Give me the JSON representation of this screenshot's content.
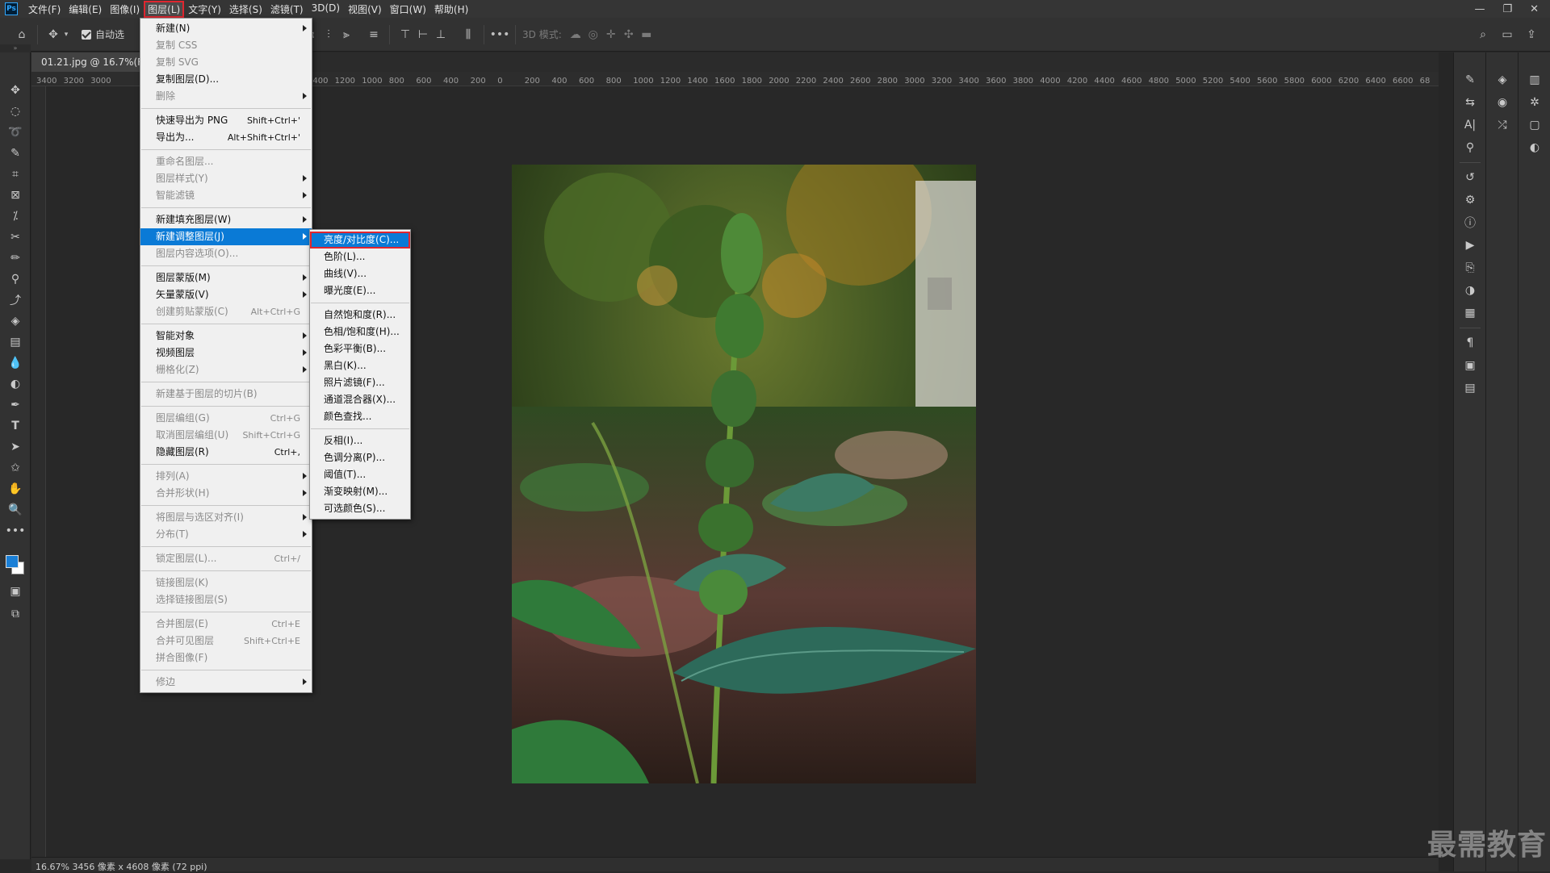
{
  "app": {
    "logo": "Ps"
  },
  "menubar": {
    "items": [
      "文件(F)",
      "编辑(E)",
      "图像(I)",
      "图层(L)",
      "文字(Y)",
      "选择(S)",
      "滤镜(T)",
      "3D(D)",
      "视图(V)",
      "窗口(W)",
      "帮助(H)"
    ],
    "active_index": 3
  },
  "window_controls": {
    "minimize": "—",
    "restore": "❐",
    "close": "✕"
  },
  "options_bar": {
    "auto_select_label": "自动选",
    "more": "•••",
    "mode_3d_label": "3D 模式:"
  },
  "document": {
    "tab_title": "01.21.jpg @ 16.7%(RGB/8)",
    "ruler_ticks": [
      "3400",
      "3200",
      "3000",
      "",
      "",
      "",
      "",
      "",
      "",
      "",
      "1400",
      "1200",
      "1000",
      "800",
      "600",
      "400",
      "200",
      "0",
      "200",
      "400",
      "600",
      "800",
      "1000",
      "1200",
      "1400",
      "1600",
      "1800",
      "2000",
      "2200",
      "2400",
      "2600",
      "2800",
      "3000",
      "3200",
      "3400",
      "3600",
      "3800",
      "4000",
      "4200",
      "4400",
      "4600",
      "4800",
      "5000",
      "5200",
      "5400",
      "5600",
      "5800",
      "6000",
      "6200",
      "6400",
      "6600",
      "68"
    ]
  },
  "status": {
    "text": "16.67%  3456 像素 x 4608 像素 (72 ppi)"
  },
  "watermark": "最需教育",
  "layer_menu": {
    "items": [
      {
        "label": "新建(N)",
        "shortcut": "",
        "submenu": true,
        "disabled": false
      },
      {
        "label": "复制 CSS",
        "shortcut": "",
        "submenu": false,
        "disabled": true
      },
      {
        "label": "复制 SVG",
        "shortcut": "",
        "submenu": false,
        "disabled": true
      },
      {
        "label": "复制图层(D)...",
        "shortcut": "",
        "submenu": false,
        "disabled": false
      },
      {
        "label": "删除",
        "shortcut": "",
        "submenu": true,
        "disabled": true
      },
      {
        "sep": true
      },
      {
        "label": "快速导出为 PNG",
        "shortcut": "Shift+Ctrl+'",
        "submenu": false,
        "disabled": false
      },
      {
        "label": "导出为...",
        "shortcut": "Alt+Shift+Ctrl+'",
        "submenu": false,
        "disabled": false
      },
      {
        "sep": true
      },
      {
        "label": "重命名图层...",
        "shortcut": "",
        "submenu": false,
        "disabled": true
      },
      {
        "label": "图层样式(Y)",
        "shortcut": "",
        "submenu": true,
        "disabled": true
      },
      {
        "label": "智能滤镜",
        "shortcut": "",
        "submenu": true,
        "disabled": true
      },
      {
        "sep": true
      },
      {
        "label": "新建填充图层(W)",
        "shortcut": "",
        "submenu": true,
        "disabled": false
      },
      {
        "label": "新建调整图层(J)",
        "shortcut": "",
        "submenu": true,
        "disabled": false,
        "highlight": true
      },
      {
        "label": "图层内容选项(O)...",
        "shortcut": "",
        "submenu": false,
        "disabled": true
      },
      {
        "sep": true
      },
      {
        "label": "图层蒙版(M)",
        "shortcut": "",
        "submenu": true,
        "disabled": false
      },
      {
        "label": "矢量蒙版(V)",
        "shortcut": "",
        "submenu": true,
        "disabled": false
      },
      {
        "label": "创建剪贴蒙版(C)",
        "shortcut": "Alt+Ctrl+G",
        "submenu": false,
        "disabled": true
      },
      {
        "sep": true
      },
      {
        "label": "智能对象",
        "shortcut": "",
        "submenu": true,
        "disabled": false
      },
      {
        "label": "视频图层",
        "shortcut": "",
        "submenu": true,
        "disabled": false
      },
      {
        "label": "栅格化(Z)",
        "shortcut": "",
        "submenu": true,
        "disabled": true
      },
      {
        "sep": true
      },
      {
        "label": "新建基于图层的切片(B)",
        "shortcut": "",
        "submenu": false,
        "disabled": true
      },
      {
        "sep": true
      },
      {
        "label": "图层编组(G)",
        "shortcut": "Ctrl+G",
        "submenu": false,
        "disabled": true
      },
      {
        "label": "取消图层编组(U)",
        "shortcut": "Shift+Ctrl+G",
        "submenu": false,
        "disabled": true
      },
      {
        "label": "隐藏图层(R)",
        "shortcut": "Ctrl+,",
        "submenu": false,
        "disabled": false
      },
      {
        "sep": true
      },
      {
        "label": "排列(A)",
        "shortcut": "",
        "submenu": true,
        "disabled": true
      },
      {
        "label": "合并形状(H)",
        "shortcut": "",
        "submenu": true,
        "disabled": true
      },
      {
        "sep": true
      },
      {
        "label": "将图层与选区对齐(I)",
        "shortcut": "",
        "submenu": true,
        "disabled": true
      },
      {
        "label": "分布(T)",
        "shortcut": "",
        "submenu": true,
        "disabled": true
      },
      {
        "sep": true
      },
      {
        "label": "锁定图层(L)...",
        "shortcut": "Ctrl+/",
        "submenu": false,
        "disabled": true
      },
      {
        "sep": true
      },
      {
        "label": "链接图层(K)",
        "shortcut": "",
        "submenu": false,
        "disabled": true
      },
      {
        "label": "选择链接图层(S)",
        "shortcut": "",
        "submenu": false,
        "disabled": true
      },
      {
        "sep": true
      },
      {
        "label": "合并图层(E)",
        "shortcut": "Ctrl+E",
        "submenu": false,
        "disabled": true
      },
      {
        "label": "合并可见图层",
        "shortcut": "Shift+Ctrl+E",
        "submenu": false,
        "disabled": true
      },
      {
        "label": "拼合图像(F)",
        "shortcut": "",
        "submenu": false,
        "disabled": true
      },
      {
        "sep": true
      },
      {
        "label": "修边",
        "shortcut": "",
        "submenu": true,
        "disabled": true
      }
    ]
  },
  "adjust_menu": {
    "items": [
      {
        "label": "亮度/对比度(C)...",
        "highlight": true
      },
      {
        "label": "色阶(L)..."
      },
      {
        "label": "曲线(V)..."
      },
      {
        "label": "曝光度(E)..."
      },
      {
        "sep": true
      },
      {
        "label": "自然饱和度(R)..."
      },
      {
        "label": "色相/饱和度(H)..."
      },
      {
        "label": "色彩平衡(B)..."
      },
      {
        "label": "黑白(K)..."
      },
      {
        "label": "照片滤镜(F)..."
      },
      {
        "label": "通道混合器(X)..."
      },
      {
        "label": "颜色查找..."
      },
      {
        "sep": true
      },
      {
        "label": "反相(I)..."
      },
      {
        "label": "色调分离(P)..."
      },
      {
        "label": "阈值(T)..."
      },
      {
        "label": "渐变映射(M)..."
      },
      {
        "label": "可选颜色(S)..."
      }
    ]
  },
  "colors": {
    "accent": "#0a7ad6",
    "highlight_box": "#e0262f",
    "foreground": "#1a7fd6",
    "background": "#ffffff"
  }
}
